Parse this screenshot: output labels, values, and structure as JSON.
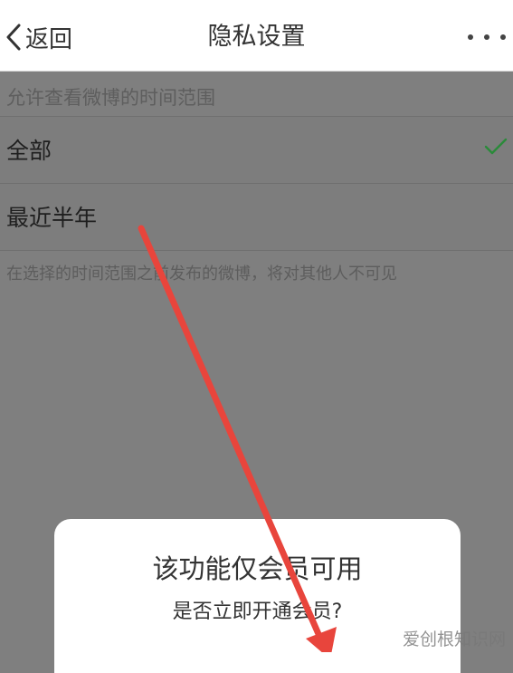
{
  "header": {
    "back_label": "返回",
    "title": "隐私设置",
    "more_icon": "more-dots-icon"
  },
  "settings": {
    "section_title": "允许查看微博的时间范围",
    "options": [
      {
        "label": "全部",
        "selected": true
      },
      {
        "label": "最近半年",
        "selected": false
      }
    ],
    "hint": "在选择的时间范围之前发布的微博，将对其他人不可见"
  },
  "dialog": {
    "title": "该功能仅会员可用",
    "message": "是否立即开通会员?"
  },
  "watermark": "爱创根知识网",
  "colors": {
    "check": "#2a8a3a",
    "arrow": "#e8453c",
    "overlay": "#7f7f7f"
  }
}
